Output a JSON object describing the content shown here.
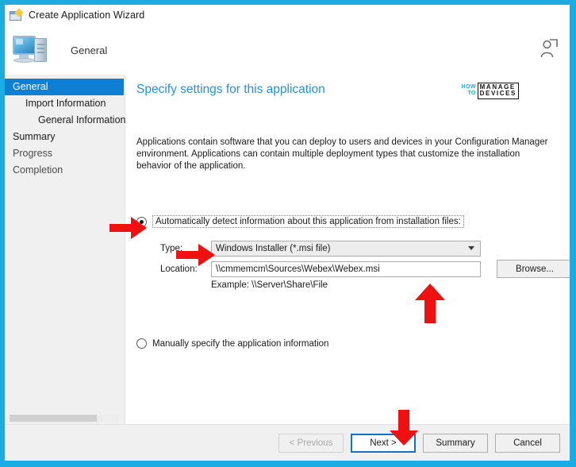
{
  "window": {
    "title": "Create Application Wizard",
    "title_icon": "wizard-window-icon",
    "header_step": "General",
    "header_icon": "computer-icon",
    "account_icon": "person-icon"
  },
  "sidebar": {
    "items": [
      {
        "label": "General",
        "level": 0,
        "selected": true
      },
      {
        "label": "Import Information",
        "level": 1,
        "selected": false
      },
      {
        "label": "General Information",
        "level": 2,
        "selected": false
      },
      {
        "label": "Summary",
        "level": 0,
        "selected": false
      },
      {
        "label": "Progress",
        "level": 0,
        "selected": false
      },
      {
        "label": "Completion",
        "level": 0,
        "selected": false
      }
    ],
    "scrollbar": "horizontal-scrollbar"
  },
  "content": {
    "title": "Specify settings for this application",
    "intro": "Applications contain software that you can deploy to users and devices in your Configuration Manager environment. Applications can contain multiple deployment types that customize the installation behavior of the application.",
    "logo": {
      "line1": "HOW",
      "line2": "TO",
      "line3": "MANAGE",
      "line4": "DEVICES"
    },
    "options": {
      "auto": {
        "label": "Automatically detect information about this application from installation files:",
        "selected": true,
        "focused": true
      },
      "manual": {
        "label": "Manually specify the application information",
        "selected": false
      }
    },
    "fields": {
      "type_label": "Type:",
      "type_value": "Windows Installer (*.msi file)",
      "location_label": "Location:",
      "location_value": "\\\\cmmemcm\\Sources\\Webex\\Webex.msi",
      "example_text": "Example: \\\\Server\\Share\\File",
      "browse_label": "Browse..."
    }
  },
  "footer": {
    "previous_label": "< Previous",
    "next_label": "Next >",
    "summary_label": "Summary",
    "cancel_label": "Cancel"
  },
  "annotations": {
    "arrow_radio": "red-arrow-right-pointing-to-radio",
    "arrow_type": "red-arrow-right-pointing-to-type-dropdown",
    "arrow_location": "red-arrow-up-pointing-to-location-field",
    "arrow_next": "red-arrow-down-pointing-to-next-button"
  },
  "colors": {
    "frame": "#1BACE4",
    "accent": "#0F7FD4",
    "title_blue": "#2D8FD6",
    "annotation_red": "#F01010"
  }
}
